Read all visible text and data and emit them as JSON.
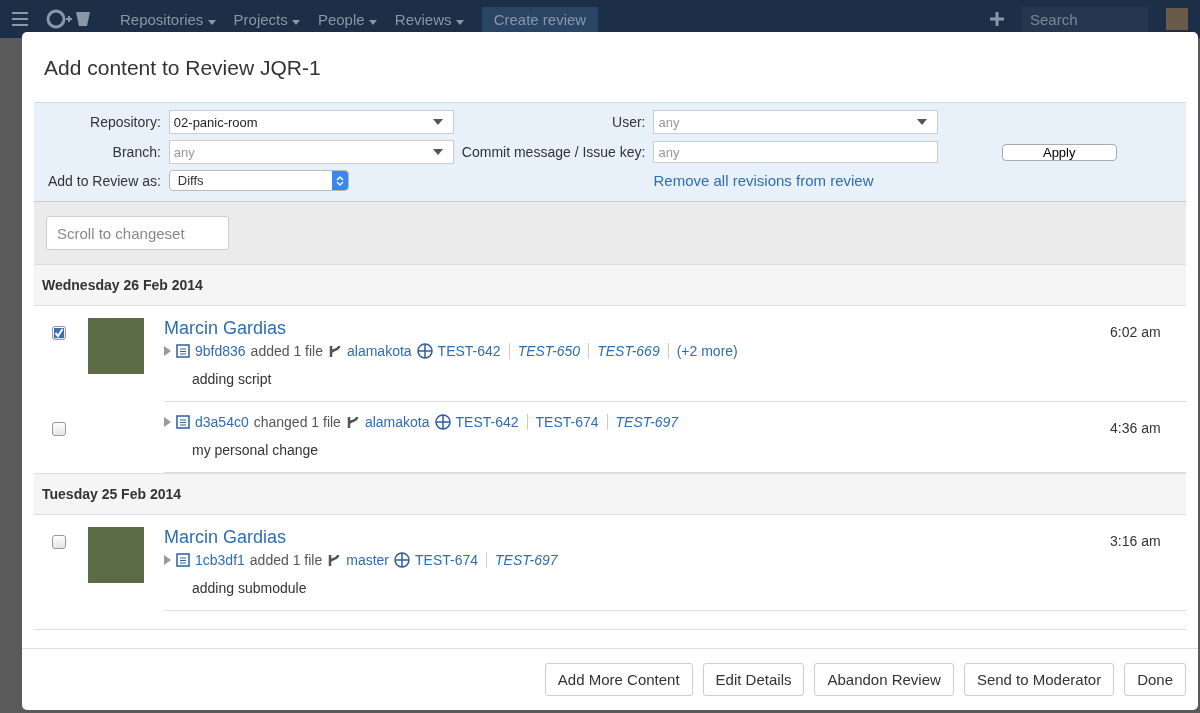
{
  "navbar": {
    "menus": [
      "Repositories",
      "Projects",
      "People",
      "Reviews"
    ],
    "create_button": "Create review",
    "search": {
      "placeholder": "Search"
    }
  },
  "dialog": {
    "title": "Add content to Review JQR-1",
    "filters": {
      "repository": {
        "label": "Repository:",
        "value": "02-panic-room"
      },
      "branch": {
        "label": "Branch:",
        "placeholder": "any"
      },
      "add_as": {
        "label": "Add to Review as:",
        "value": "Diffs"
      },
      "user": {
        "label": "User:",
        "placeholder": "any"
      },
      "commit": {
        "label": "Commit message / Issue key:",
        "placeholder": "any"
      },
      "apply": "Apply",
      "remove_link": "Remove all revisions from review"
    },
    "scroll_field": {
      "placeholder": "Scroll to changeset"
    },
    "days": [
      {
        "date": "Wednesday 26 Feb 2014",
        "changesets": [
          {
            "author": "Marcin Gardias",
            "checked": true,
            "hash": "9bfd836",
            "action": "added 1 file",
            "branch": "alamakota",
            "issues": [
              {
                "key": "TEST-642",
                "italic": false
              },
              {
                "key": "TEST-650",
                "italic": true
              },
              {
                "key": "TEST-669",
                "italic": true
              }
            ],
            "more": "(+2 more)",
            "message": "adding script",
            "time": "6:02 am"
          },
          {
            "checked": false,
            "hash": "d3a54c0",
            "action": "changed 1 file",
            "branch": "alamakota",
            "issues": [
              {
                "key": "TEST-642",
                "italic": false
              },
              {
                "key": "TEST-674",
                "italic": false
              },
              {
                "key": "TEST-697",
                "italic": true
              }
            ],
            "message": "my personal change",
            "time": "4:36 am"
          }
        ]
      },
      {
        "date": "Tuesday 25 Feb 2014",
        "changesets": [
          {
            "author": "Marcin Gardias",
            "checked": false,
            "hash": "1cb3df1",
            "action": "added 1 file",
            "branch": "master",
            "issues": [
              {
                "key": "TEST-674",
                "italic": false
              },
              {
                "key": "TEST-697",
                "italic": true
              }
            ],
            "message": "adding submodule",
            "time": "3:16 am"
          }
        ]
      }
    ],
    "buttons": [
      "Add More Content",
      "Edit Details",
      "Abandon Review",
      "Send to Moderator",
      "Done"
    ]
  }
}
